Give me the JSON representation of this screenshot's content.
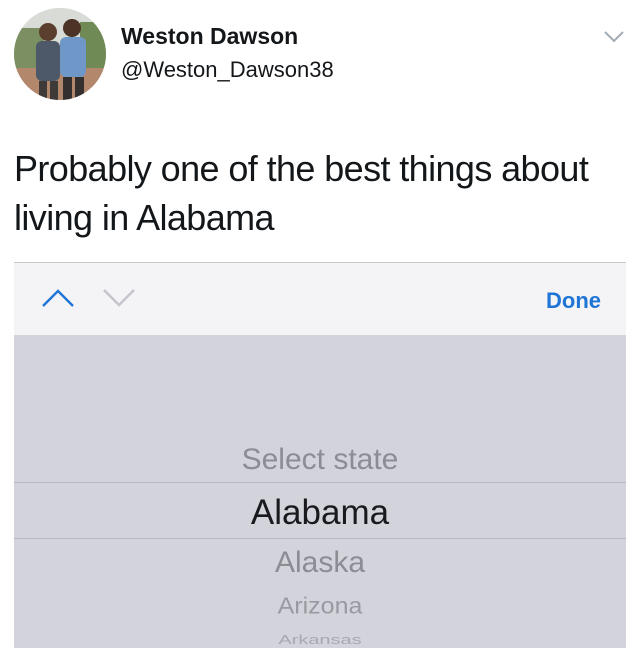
{
  "tweet": {
    "author": {
      "name": "Weston Dawson",
      "handle": "@Weston_Dawson38"
    },
    "text": "Probably one of the best things about living in Alabama",
    "menu_icon": "chevron-down-icon"
  },
  "screenshot": {
    "toolbar": {
      "prev_icon": "chevron-up-icon",
      "next_icon": "chevron-down-icon",
      "done_label": "Done"
    },
    "picker": {
      "prompt": "Select state",
      "selected": "Alabama",
      "options": [
        "Alaska",
        "Arizona",
        "Arkansas"
      ]
    },
    "colors": {
      "accent": "#1f75d6",
      "picker_bg": "#d3d4db",
      "toolbar_bg": "#f4f4f6"
    }
  }
}
